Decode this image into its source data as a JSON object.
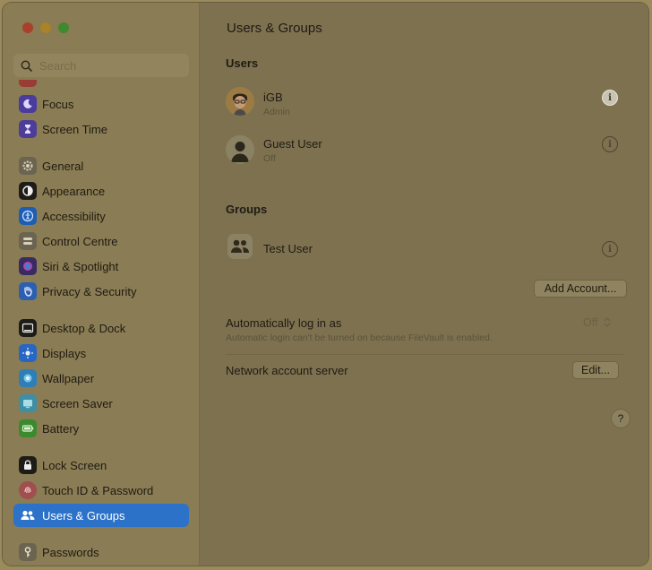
{
  "sidebar": {
    "search_placeholder": "Search",
    "items": [
      {
        "label": "Focus",
        "icon": "moon-icon",
        "color": "#4a3c9c"
      },
      {
        "label": "Screen Time",
        "icon": "hourglass-icon",
        "color": "#4c3d99"
      },
      {
        "label": "General",
        "icon": "gear-icon",
        "color": "#6b6450"
      },
      {
        "label": "Appearance",
        "icon": "appearance-icon",
        "color": "#1e1c16"
      },
      {
        "label": "Accessibility",
        "icon": "accessibility-icon",
        "color": "#1d5eb5"
      },
      {
        "label": "Control Centre",
        "icon": "control-centre-icon",
        "color": "#6b6450"
      },
      {
        "label": "Siri & Spotlight",
        "icon": "siri-icon",
        "color": "#3a2a62"
      },
      {
        "label": "Privacy & Security",
        "icon": "hand-icon",
        "color": "#2c5fb0"
      },
      {
        "label": "Desktop & Dock",
        "icon": "dock-icon",
        "color": "#1e1c16"
      },
      {
        "label": "Displays",
        "icon": "sun-icon",
        "color": "#2766c2"
      },
      {
        "label": "Wallpaper",
        "icon": "wallpaper-icon",
        "color": "#2e7fb8"
      },
      {
        "label": "Screen Saver",
        "icon": "screen-saver-icon",
        "color": "#3e8ea6"
      },
      {
        "label": "Battery",
        "icon": "battery-icon",
        "color": "#3b8a2e"
      },
      {
        "label": "Lock Screen",
        "icon": "lock-icon",
        "color": "#1e1c16"
      },
      {
        "label": "Touch ID & Password",
        "icon": "fingerprint-icon",
        "color": "#a04e4e"
      },
      {
        "label": "Users & Groups",
        "icon": "users-icon",
        "color": "#2c72c9",
        "selected": true
      },
      {
        "label": "Passwords",
        "icon": "key-icon",
        "color": "#6b6450"
      }
    ]
  },
  "main": {
    "title": "Users & Groups",
    "users_heading": "Users",
    "users": [
      {
        "name": "iGB",
        "role": "Admin"
      },
      {
        "name": "Guest User",
        "role": "Off"
      }
    ],
    "groups_heading": "Groups",
    "groups": [
      {
        "name": "Test User"
      }
    ],
    "add_account_label": "Add Account...",
    "auto_login": {
      "label": "Automatically log in as",
      "note": "Automatic login can't be turned on because FileVault is enabled.",
      "value": "Off"
    },
    "network_server": {
      "label": "Network account server",
      "button": "Edit..."
    },
    "help_label": "?"
  },
  "colors": {
    "accent": "#2c72c9"
  }
}
